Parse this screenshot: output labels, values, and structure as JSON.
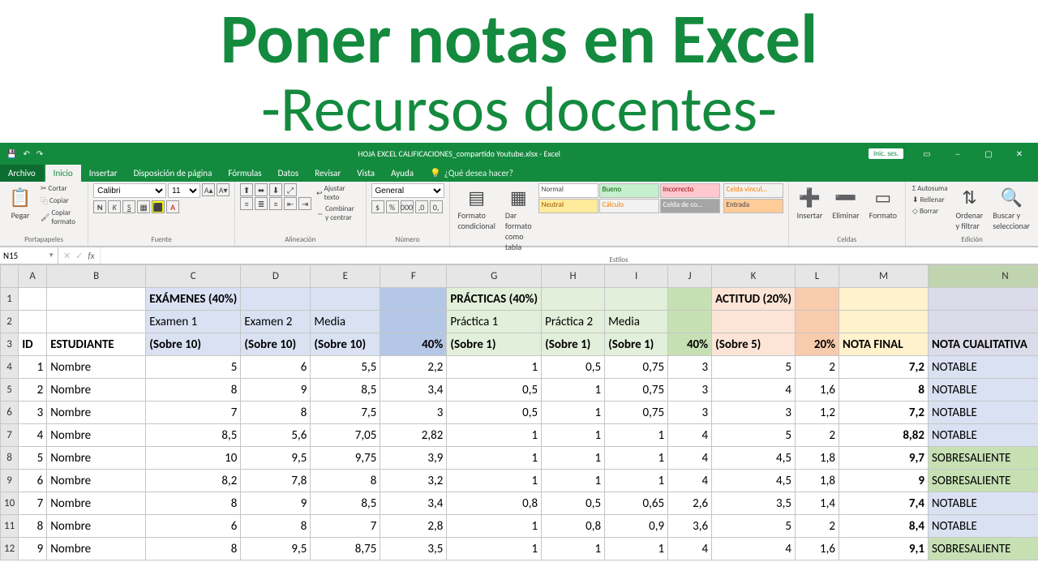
{
  "headline": {
    "title": "Poner notas en Excel",
    "subtitle": "-Recursos docentes-"
  },
  "titlebar": {
    "doc": "HOJA EXCEL CALIFICACIONES_compartido Youtube.xlsx - Excel",
    "signin": "Inic. ses."
  },
  "menu": {
    "file": "Archivo",
    "home": "Inicio",
    "insert": "Insertar",
    "layout": "Disposición de página",
    "formulas": "Fórmulas",
    "data": "Datos",
    "review": "Revisar",
    "view": "Vista",
    "help": "Ayuda",
    "tellme": "¿Qué desea hacer?"
  },
  "ribbon": {
    "paste": "Pegar",
    "cut": "Cortar",
    "copy": "Copiar",
    "painter": "Copiar formato",
    "clipboard": "Portapapeles",
    "font_name": "Calibri",
    "font_size": "11",
    "font_grp": "Fuente",
    "wrap": "Ajustar texto",
    "merge": "Combinar y centrar",
    "align_grp": "Alineación",
    "numfmt": "General",
    "num_grp": "Número",
    "cond": "Formato condicional",
    "astable": "Dar formato como tabla",
    "styles_grp": "Estilos",
    "s_normal": "Normal",
    "s_bueno": "Bueno",
    "s_incorr": "Incorrecto",
    "s_neutral": "Neutral",
    "s_calc": "Cálculo",
    "s_celda": "Celda de co…",
    "s_vincul": "Celda vincul…",
    "s_entrada": "Entrada",
    "insertc": "Insertar",
    "delete": "Eliminar",
    "format": "Formato",
    "cells_grp": "Celdas",
    "autosum": "Autosuma",
    "fill": "Rellenar",
    "clear": "Borrar",
    "sort": "Ordenar y filtrar",
    "find": "Buscar y seleccionar",
    "edit_grp": "Edición"
  },
  "fbar": {
    "name": "N15",
    "fx": "fx"
  },
  "cols": [
    "A",
    "B",
    "C",
    "D",
    "E",
    "F",
    "G",
    "H",
    "I",
    "J",
    "K",
    "L",
    "M",
    "N"
  ],
  "widths": [
    35,
    122,
    86,
    86,
    86,
    82,
    78,
    78,
    78,
    54,
    68,
    54,
    110,
    190
  ],
  "row1": {
    "exam": "EXÁMENES (40%)",
    "prac": "PRÁCTICAS (40%)",
    "act": "ACTITUD (20%)"
  },
  "row2": {
    "e1": "Examen 1",
    "e2": "Examen 2",
    "em": "Media",
    "p1": "Práctica 1",
    "p2": "Práctica 2",
    "pm": "Media"
  },
  "row3": {
    "id": "ID",
    "est": "ESTUDIANTE",
    "s10": "(Sobre 10)",
    "p40": "40%",
    "s1": "(Sobre 1)",
    "s5": "(Sobre 5)",
    "p20": "20%",
    "nf": "NOTA FINAL",
    "nc": "NOTA CUALITATIVA"
  },
  "students": [
    {
      "id": "1",
      "n": "Nombre",
      "e1": "5",
      "e2": "6",
      "em": "5,5",
      "ew": "2,2",
      "p1": "1",
      "p2": "0,5",
      "pm": "0,75",
      "pw": "3",
      "a": "5",
      "aw": "2",
      "nf": "7,2",
      "nc": "NOTABLE",
      "q": "n"
    },
    {
      "id": "2",
      "n": "Nombre",
      "e1": "8",
      "e2": "9",
      "em": "8,5",
      "ew": "3,4",
      "p1": "0,5",
      "p2": "1",
      "pm": "0,75",
      "pw": "3",
      "a": "4",
      "aw": "1,6",
      "nf": "8",
      "nc": "NOTABLE",
      "q": "n"
    },
    {
      "id": "3",
      "n": "Nombre",
      "e1": "7",
      "e2": "8",
      "em": "7,5",
      "ew": "3",
      "p1": "0,5",
      "p2": "1",
      "pm": "0,75",
      "pw": "3",
      "a": "3",
      "aw": "1,2",
      "nf": "7,2",
      "nc": "NOTABLE",
      "q": "n"
    },
    {
      "id": "4",
      "n": "Nombre",
      "e1": "8,5",
      "e2": "5,6",
      "em": "7,05",
      "ew": "2,82",
      "p1": "1",
      "p2": "1",
      "pm": "1",
      "pw": "4",
      "a": "5",
      "aw": "2",
      "nf": "8,82",
      "nc": "NOTABLE",
      "q": "n"
    },
    {
      "id": "5",
      "n": "Nombre",
      "e1": "10",
      "e2": "9,5",
      "em": "9,75",
      "ew": "3,9",
      "p1": "1",
      "p2": "1",
      "pm": "1",
      "pw": "4",
      "a": "4,5",
      "aw": "1,8",
      "nf": "9,7",
      "nc": "SOBRESALIENTE",
      "q": "s"
    },
    {
      "id": "6",
      "n": "Nombre",
      "e1": "8,2",
      "e2": "7,8",
      "em": "8",
      "ew": "3,2",
      "p1": "1",
      "p2": "1",
      "pm": "1",
      "pw": "4",
      "a": "4,5",
      "aw": "1,8",
      "nf": "9",
      "nc": "SOBRESALIENTE",
      "q": "s"
    },
    {
      "id": "7",
      "n": "Nombre",
      "e1": "8",
      "e2": "9",
      "em": "8,5",
      "ew": "3,4",
      "p1": "0,8",
      "p2": "0,5",
      "pm": "0,65",
      "pw": "2,6",
      "a": "3,5",
      "aw": "1,4",
      "nf": "7,4",
      "nc": "NOTABLE",
      "q": "n"
    },
    {
      "id": "8",
      "n": "Nombre",
      "e1": "6",
      "e2": "8",
      "em": "7",
      "ew": "2,8",
      "p1": "1",
      "p2": "0,8",
      "pm": "0,9",
      "pw": "3,6",
      "a": "5",
      "aw": "2",
      "nf": "8,4",
      "nc": "NOTABLE",
      "q": "n"
    },
    {
      "id": "9",
      "n": "Nombre",
      "e1": "8",
      "e2": "9,5",
      "em": "8,75",
      "ew": "3,5",
      "p1": "1",
      "p2": "1",
      "pm": "1",
      "pw": "4",
      "a": "4",
      "aw": "1,6",
      "nf": "9,1",
      "nc": "SOBRESALIENTE",
      "q": "s"
    }
  ]
}
